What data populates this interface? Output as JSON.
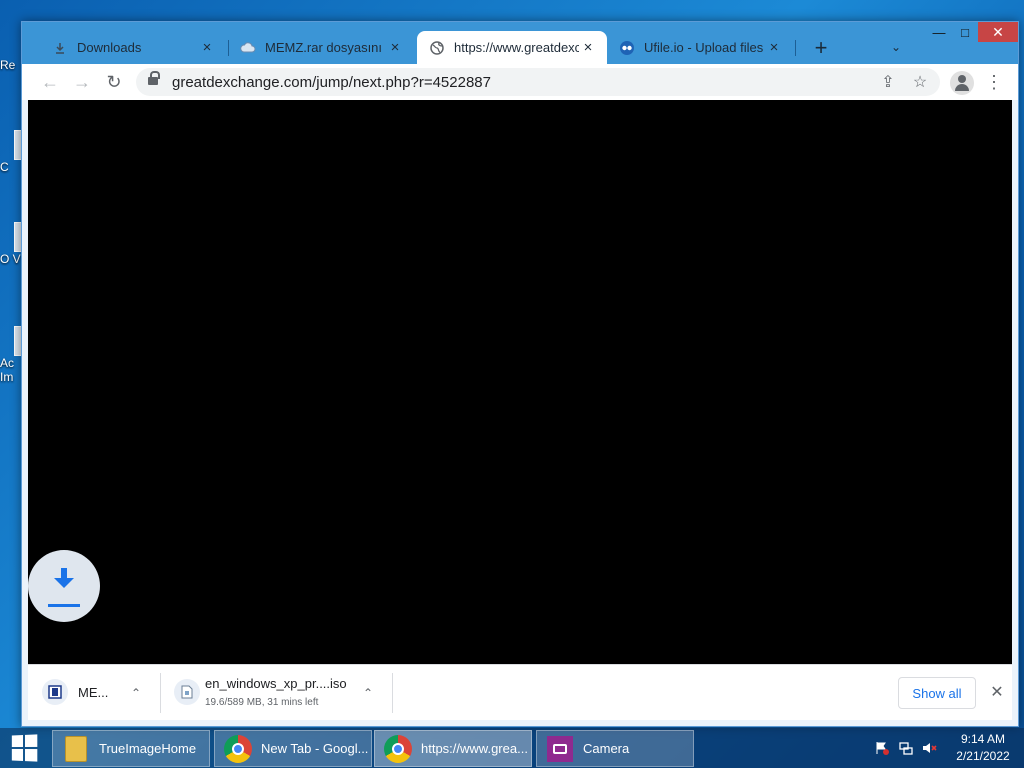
{
  "desktop": {
    "icons": [
      {
        "label": "Re"
      },
      {
        "label": "C"
      },
      {
        "label": "O V"
      },
      {
        "label": "Ac Im"
      }
    ]
  },
  "browser": {
    "tabs": [
      {
        "title": "Downloads",
        "icon": "download-icon",
        "active": false
      },
      {
        "title": "MEMZ.rar dosyasını indir",
        "icon": "cloud-icon",
        "active": false
      },
      {
        "title": "https://www.greatdexchange.com",
        "icon": "globe-icon",
        "active": true
      },
      {
        "title": "Ufile.io - Upload files for free",
        "icon": "ufile-icon",
        "active": false
      }
    ],
    "new_tab_symbol": "+",
    "tab_search_symbol": "⌄",
    "window_controls": {
      "minimize": "—",
      "maximize": "□",
      "close": "✕"
    },
    "nav": {
      "back": "←",
      "forward": "→",
      "reload": "↻"
    },
    "url": "greatdexchange.com/jump/next.php?r=4522887",
    "share_symbol": "⇪",
    "bookmark_symbol": "☆",
    "menu_symbol": "⋮"
  },
  "download_shelf": {
    "items": [
      {
        "name": "ME...",
        "status": "",
        "icon": "rar-icon"
      },
      {
        "name": "en_windows_xp_pr....iso",
        "status": "19.6/589 MB, 31 mins left",
        "icon": "file-icon"
      }
    ],
    "chevron_symbol": "⌃",
    "show_all_label": "Show all",
    "close_symbol": "✕"
  },
  "taskbar": {
    "items": [
      {
        "label": "TrueImageHome",
        "icon": "folder-icon"
      },
      {
        "label": "New Tab - Googl...",
        "icon": "chrome-icon"
      },
      {
        "label": "https://www.grea...",
        "icon": "chrome-icon",
        "active": true
      },
      {
        "label": "Camera",
        "icon": "camera-icon"
      }
    ],
    "tray": {
      "time": "9:14 AM",
      "date": "2/21/2022"
    }
  }
}
